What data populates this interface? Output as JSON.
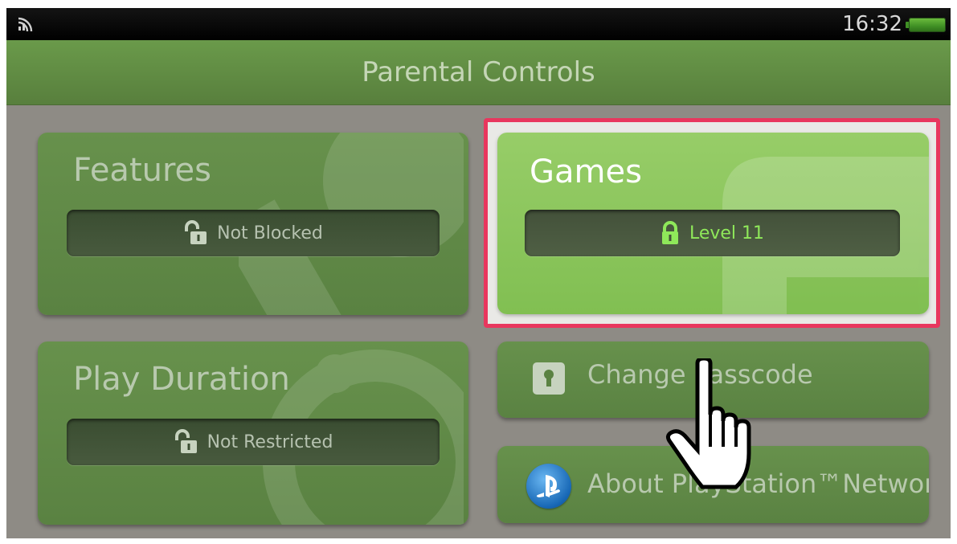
{
  "status_bar": {
    "time": "16:32",
    "wifi_icon": "wifi-icon",
    "battery_icon": "battery-icon"
  },
  "header": {
    "title": "Parental Controls"
  },
  "tiles": {
    "features": {
      "title": "Features",
      "status": "Not Blocked",
      "icon": "unlocked-padlock-icon"
    },
    "games": {
      "title": "Games",
      "status": "Level 11",
      "icon": "locked-padlock-icon",
      "selected": true
    },
    "play_duration": {
      "title": "Play Duration",
      "status": "Not Restricted",
      "icon": "unlocked-padlock-icon"
    }
  },
  "buttons": {
    "change_passcode": {
      "label": "Change Passcode",
      "icon": "keyhole-icon"
    },
    "about_psn": {
      "label": "About PlayStation™Network",
      "icon": "playstation-logo-icon"
    }
  },
  "colors": {
    "accent_green": "#81bf52",
    "tile_green": "#5a8242",
    "selection_outline": "#e8375e",
    "level_text": "#8fe85a"
  },
  "cursor": {
    "icon": "hand-pointer-cursor-icon"
  }
}
